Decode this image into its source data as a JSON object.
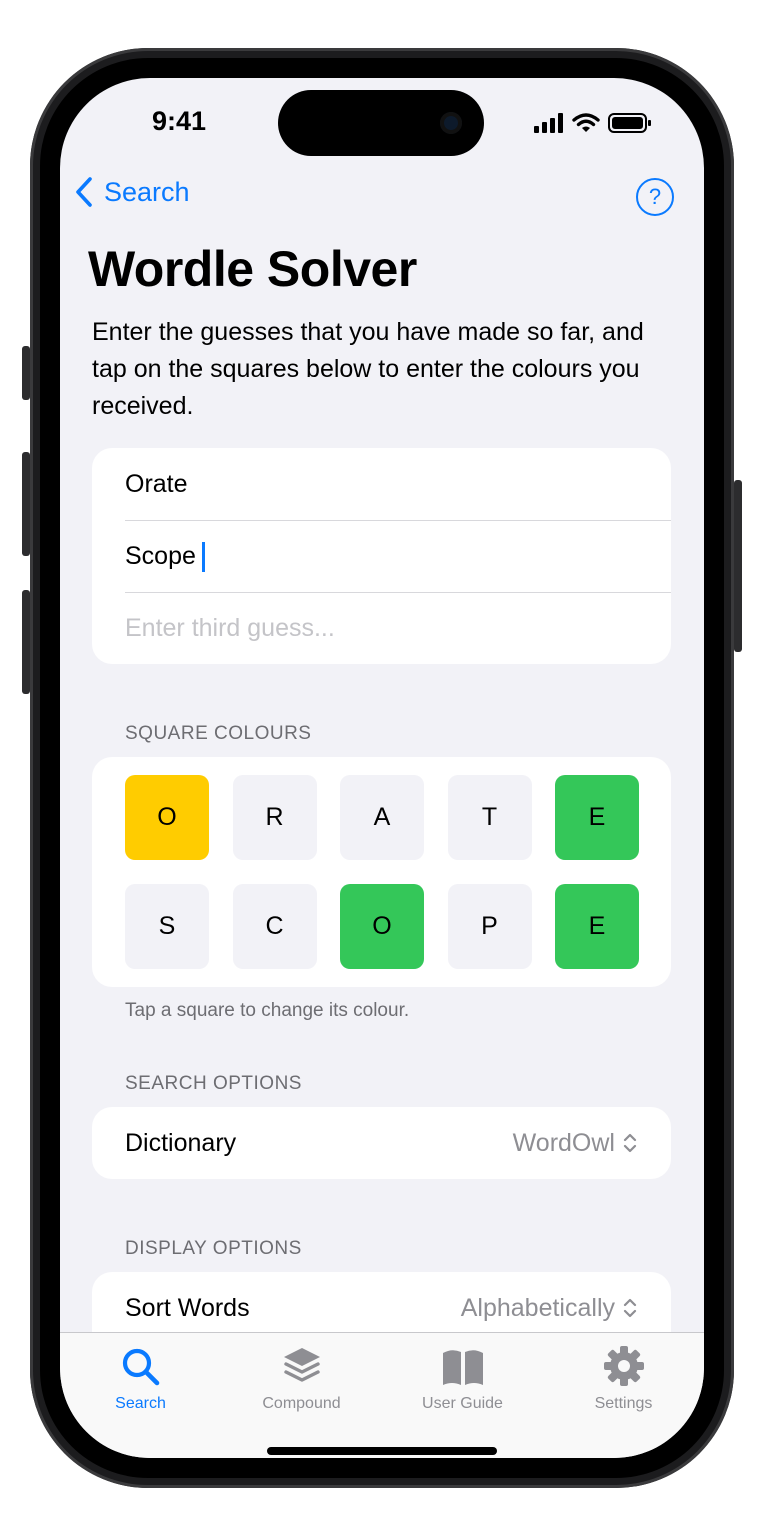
{
  "status_bar": {
    "time": "9:41"
  },
  "nav": {
    "back_label": "Search",
    "help_symbol": "?"
  },
  "page": {
    "title": "Wordle Solver",
    "intro": "Enter the guesses that you have made so far, and tap on the squares below to enter the colours you received."
  },
  "guesses": {
    "first": {
      "value": "Orate"
    },
    "second": {
      "value": "Scope"
    },
    "third": {
      "value": "",
      "placeholder": "Enter third guess..."
    }
  },
  "square_colours": {
    "header": "SQUARE COLOURS",
    "footnote": "Tap a square to change its colour.",
    "colors": {
      "yellow": "#ffcc00",
      "green": "#34c759",
      "grey": "#f2f2f7"
    },
    "rows": [
      [
        {
          "letter": "O",
          "state": "yellow"
        },
        {
          "letter": "R",
          "state": "grey"
        },
        {
          "letter": "A",
          "state": "grey"
        },
        {
          "letter": "T",
          "state": "grey"
        },
        {
          "letter": "E",
          "state": "green"
        }
      ],
      [
        {
          "letter": "S",
          "state": "grey"
        },
        {
          "letter": "C",
          "state": "grey"
        },
        {
          "letter": "O",
          "state": "green"
        },
        {
          "letter": "P",
          "state": "grey"
        },
        {
          "letter": "E",
          "state": "green"
        }
      ]
    ]
  },
  "search_options": {
    "header": "SEARCH OPTIONS",
    "dictionary": {
      "label": "Dictionary",
      "value": "WordOwl"
    }
  },
  "display_options": {
    "header": "DISPLAY OPTIONS",
    "sort_words": {
      "label": "Sort Words",
      "value": "Alphabetically"
    }
  },
  "tabbar": {
    "accent": "#0a7aff",
    "tabs": [
      {
        "label": "Search",
        "icon": "magnifying-glass-icon",
        "active": true
      },
      {
        "label": "Compound",
        "icon": "stacked-layers-icon",
        "active": false
      },
      {
        "label": "User Guide",
        "icon": "open-book-icon",
        "active": false
      },
      {
        "label": "Settings",
        "icon": "gear-icon",
        "active": false
      }
    ]
  }
}
